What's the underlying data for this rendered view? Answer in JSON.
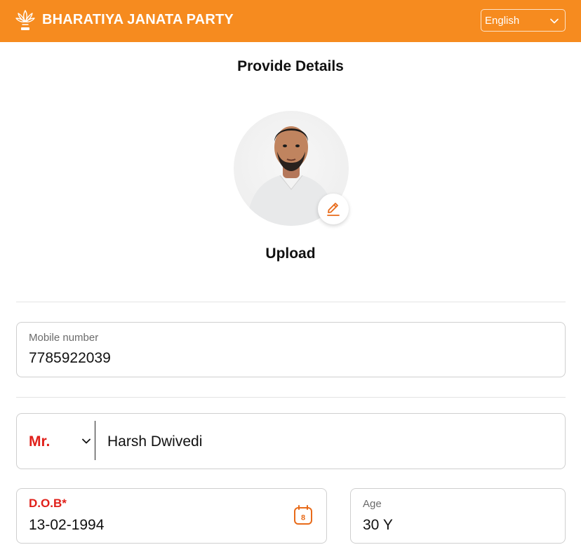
{
  "header": {
    "brand": "BHARATIYA JANATA PARTY",
    "language": "English",
    "background": "#f68b1f"
  },
  "title": "Provide Details",
  "photo": {
    "upload_label": "Upload",
    "edit_icon": "pencil-icon"
  },
  "form": {
    "mobile": {
      "label": "Mobile number",
      "value": "7785922039"
    },
    "name": {
      "salutation": "Mr.",
      "value": "Harsh Dwivedi"
    },
    "dob": {
      "label": "D.O.B*",
      "value": "13-02-1994",
      "calendar_day": "8"
    },
    "age": {
      "label": "Age",
      "value": "30 Y"
    }
  },
  "colors": {
    "accent": "#f68b1f",
    "required": "#e0201a"
  }
}
